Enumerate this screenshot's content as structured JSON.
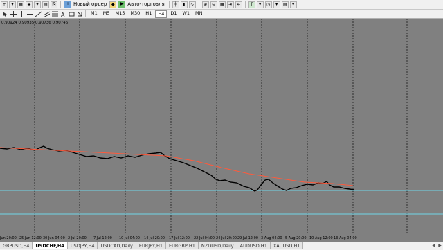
{
  "toolbar": {
    "new_order_label": "Новый ордер",
    "autotrading_label": "Авто-торговля"
  },
  "periods": [
    "M1",
    "M5",
    "M15",
    "M30",
    "H1",
    "H4",
    "D1",
    "W1",
    "MN"
  ],
  "active_period": "H4",
  "ohlc_text": "0.90924 0.90935 0.90736 0.90746",
  "time_labels": [
    "Jun 20:00",
    "25 Jun 12:00",
    "30 Jun 04:00",
    "2 Jul 20:00",
    "7 Jul 12:00",
    "10 Jul 04:00",
    "14 Jul 20:00",
    "17 Jul 12:00",
    "22 Jul 04:00",
    "24 Jul 20:00",
    "29 Jul 12:00",
    "3 Aug 04:00",
    "5 Aug 20:00",
    "10 Aug 12:00",
    "13 Aug 04:00"
  ],
  "tabs": [
    "GBPUSD,H4",
    "USDCHF,H4",
    "USDJPY,H4",
    "USDCAD,Daily",
    "EURJPY,H1",
    "EURGBP,H1",
    "NZDUSD,Daily",
    "AUDUSD,H1",
    "XAUUSD,H1"
  ],
  "active_tab": "USDCHF,H4",
  "colors": {
    "chart_bg": "#808080",
    "price": "#000000",
    "moving_average": "#ff5a3c",
    "horizontal_line": "#6fd6e8",
    "grid": "#1a1a1a"
  }
}
